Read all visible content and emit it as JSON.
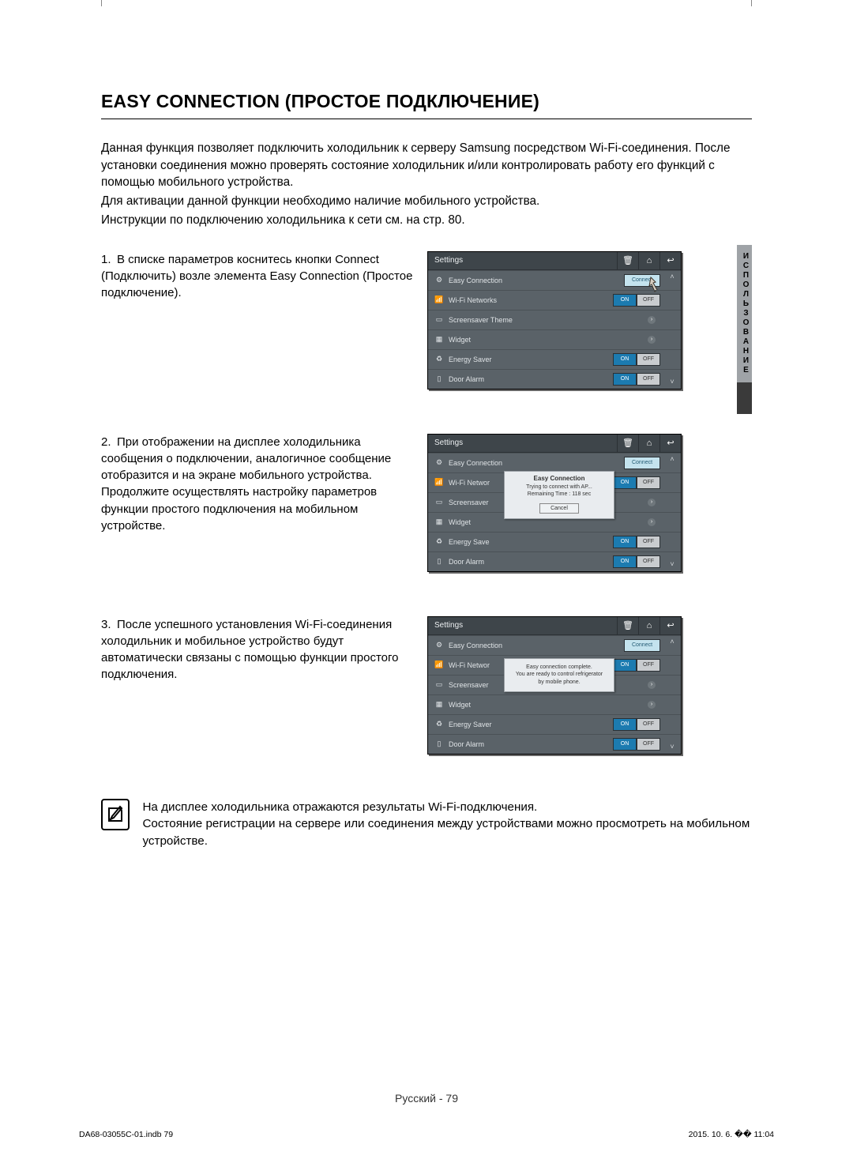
{
  "heading": "EASY CONNECTION (ПРОСТОЕ ПОДКЛЮЧЕНИЕ)",
  "intro": {
    "p1": "Данная функция позволяет подключить холодильник к серверу Samsung посредством Wi-Fi-соединения. После установки соединения можно проверять состояние холодильник и/или контролировать работу его функций с помощью мобильного устройства.",
    "p2": "Для активации данной функции необходимо наличие мобильного устройства.",
    "p3": "Инструкции по подключению холодильника к сети см. на стр. 80."
  },
  "tab_label": "ИСПОЛЬЗОВАНИЕ",
  "steps": [
    {
      "num": "1.",
      "text": "В списке параметров коснитесь кнопки Connect (Подключить) возле элемента Easy Connection (Простое подключение).",
      "panel": {
        "title": "Settings",
        "rows": [
          {
            "icon": "gear",
            "label": "Easy Connection",
            "ctrl": "connect",
            "connect_label": "Connect",
            "pointer": true
          },
          {
            "icon": "wifi",
            "label": "Wi-Fi Networks",
            "ctrl": "onoff",
            "on": "ON",
            "off": "OFF"
          },
          {
            "icon": "screen",
            "label": "Screensaver Theme",
            "ctrl": "chev"
          },
          {
            "icon": "widget",
            "label": "Widget",
            "ctrl": "chev"
          },
          {
            "icon": "leaf",
            "label": "Energy Saver",
            "ctrl": "onoff",
            "on": "ON",
            "off": "OFF"
          },
          {
            "icon": "door",
            "label": "Door Alarm",
            "ctrl": "onoff",
            "on": "ON",
            "off": "OFF"
          }
        ]
      }
    },
    {
      "num": "2.",
      "text": "При отображении на дисплее холодильника сообщения о подключении, аналогичное сообщение отобразится и на экране мобильного устройства. Продолжите осуществлять настройку параметров функции простого подключения на мобильном устройстве.",
      "panel": {
        "title": "Settings",
        "rows": [
          {
            "icon": "gear",
            "label": "Easy Connection",
            "ctrl": "connect",
            "connect_label": "Connect"
          },
          {
            "icon": "wifi",
            "label": "Wi-Fi Networ",
            "ctrl": "onoff",
            "on": "ON",
            "off": "OFF"
          },
          {
            "icon": "screen",
            "label": "Screensaver",
            "ctrl": "chev"
          },
          {
            "icon": "widget",
            "label": "Widget",
            "ctrl": "chev"
          },
          {
            "icon": "leaf",
            "label": "Energy Save",
            "ctrl": "onoff",
            "on": "ON",
            "off": "OFF"
          },
          {
            "icon": "door",
            "label": "Door Alarm",
            "ctrl": "onoff",
            "on": "ON",
            "off": "OFF"
          }
        ],
        "popup": {
          "title": "Easy Connection",
          "msg1": "Trying to connect with AP...",
          "msg2": "Remaining Time : 118 sec",
          "cancel": "Cancel"
        }
      }
    },
    {
      "num": "3.",
      "text": "После успешного установления Wi-Fi-соединения холодильник и мобильное устройство будут автоматически связаны с помощью функции простого подключения.",
      "panel": {
        "title": "Settings",
        "rows": [
          {
            "icon": "gear",
            "label": "Easy Connection",
            "ctrl": "connect",
            "connect_label": "Connect"
          },
          {
            "icon": "wifi",
            "label": "Wi-Fi Networ",
            "ctrl": "onoff",
            "on": "ON",
            "off": "OFF"
          },
          {
            "icon": "screen",
            "label": "Screensaver",
            "ctrl": "chev"
          },
          {
            "icon": "widget",
            "label": "Widget",
            "ctrl": "chev"
          },
          {
            "icon": "leaf",
            "label": "Energy Saver",
            "ctrl": "onoff",
            "on": "ON",
            "off": "OFF"
          },
          {
            "icon": "door",
            "label": "Door Alarm",
            "ctrl": "onoff",
            "on": "ON",
            "off": "OFF"
          }
        ],
        "popup": {
          "title": "",
          "msg1": "Easy connection complete.",
          "msg2": "You are ready to control refrigerator",
          "msg3": "by mobile phone."
        }
      }
    }
  ],
  "note": {
    "l1": "На дисплее холодильника отражаются результаты Wi-Fi-подключения.",
    "l2": "Состояние регистрации на сервере или соединения между устройствами можно просмотреть на мобильном устройстве."
  },
  "page_label": "Русский - 79",
  "footer_left": "DA68-03055C-01.indb   79",
  "footer_right": "2015. 10. 6.   �� 11:04",
  "icons": {
    "trash": "🗑",
    "home": "⌂",
    "back": "↩"
  }
}
